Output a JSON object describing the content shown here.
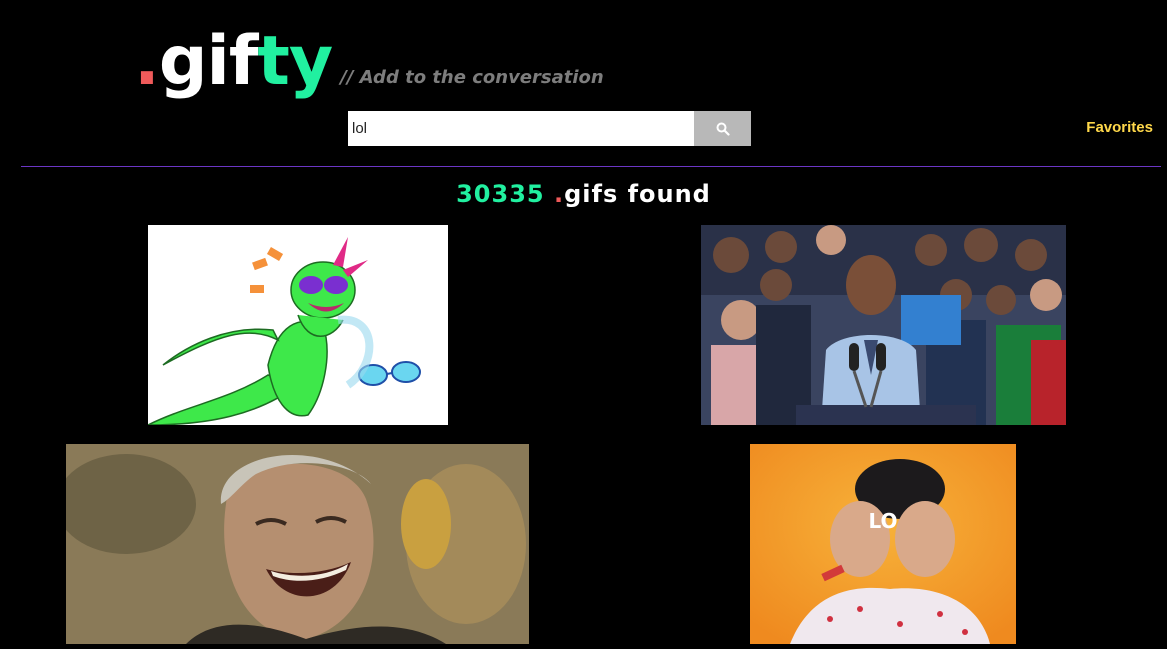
{
  "header": {
    "logo": {
      "dot": ".",
      "gif": "gif",
      "ty": "ty"
    },
    "tagline": "// Add to the conversation"
  },
  "search": {
    "value": "lol",
    "button_icon": "search-icon"
  },
  "nav": {
    "favorites_label": "Favorites"
  },
  "results": {
    "count": "30335",
    "dot": ".",
    "suffix": "gifs found"
  },
  "gifs": [
    {
      "subject": "lizard-laughing-cartoon"
    },
    {
      "subject": "man-laughing-at-podium"
    },
    {
      "subject": "man-laughing-vintage"
    },
    {
      "subject": "person-laughing-lol",
      "overlay_text": "LO"
    }
  ],
  "colors": {
    "background": "#000000",
    "accent_green": "#21f0a0",
    "accent_red": "#ef5a5a",
    "favorites": "#ffd84a",
    "divider": "#6b36c5"
  }
}
